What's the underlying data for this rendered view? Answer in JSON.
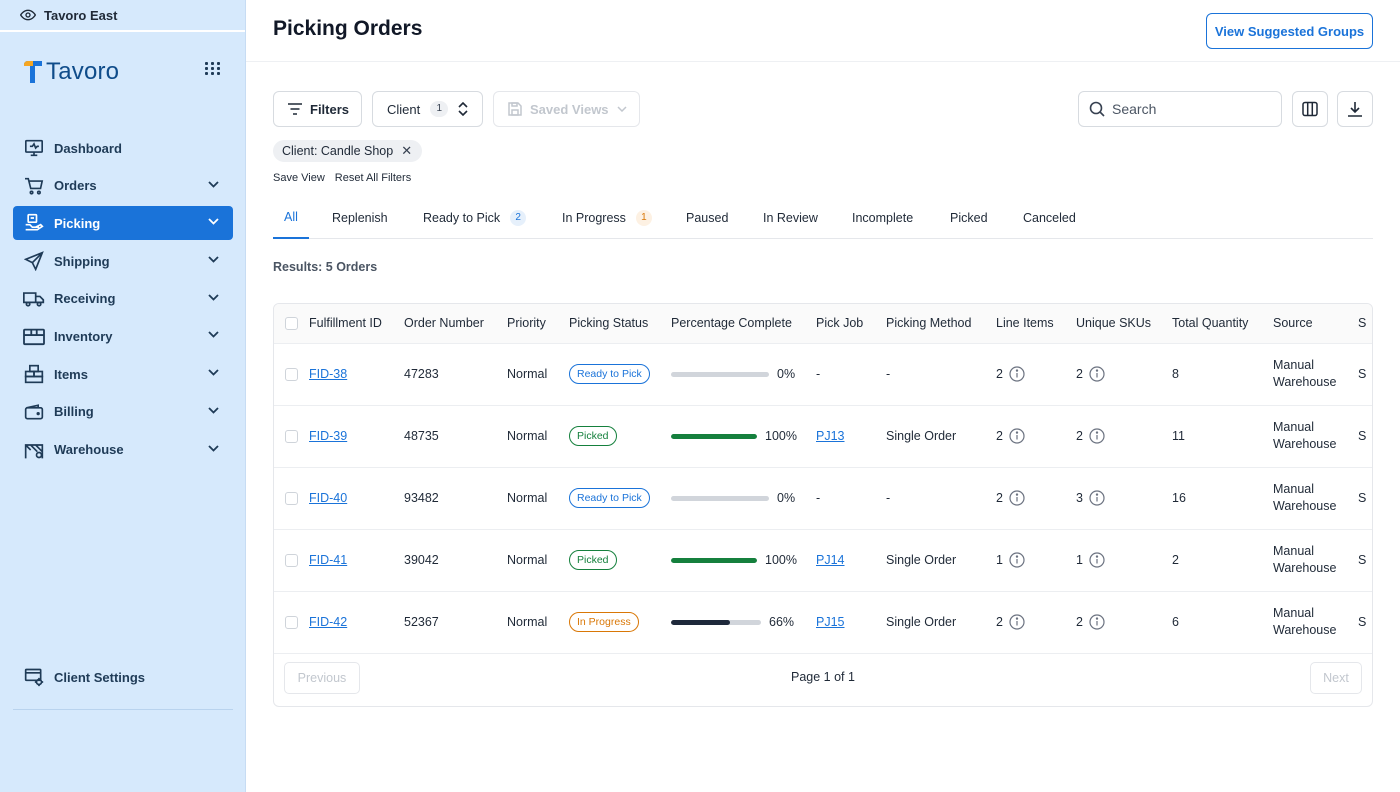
{
  "sidebar": {
    "tenant": "Tavoro East",
    "brand": "Tavoro",
    "items": [
      {
        "label": "Dashboard",
        "icon": "monitor-icon",
        "expandable": false,
        "active": false
      },
      {
        "label": "Orders",
        "icon": "cart-icon",
        "expandable": true,
        "active": false
      },
      {
        "label": "Picking",
        "icon": "picking-icon",
        "expandable": true,
        "active": true
      },
      {
        "label": "Shipping",
        "icon": "send-icon",
        "expandable": true,
        "active": false
      },
      {
        "label": "Receiving",
        "icon": "truck-icon",
        "expandable": true,
        "active": false
      },
      {
        "label": "Inventory",
        "icon": "box-icon",
        "expandable": true,
        "active": false
      },
      {
        "label": "Items",
        "icon": "boxes-icon",
        "expandable": true,
        "active": false
      },
      {
        "label": "Billing",
        "icon": "wallet-icon",
        "expandable": true,
        "active": false
      },
      {
        "label": "Warehouse",
        "icon": "warehouse-icon",
        "expandable": true,
        "active": false
      }
    ],
    "client_settings": "Client Settings"
  },
  "header": {
    "title": "Picking Orders",
    "suggest_button": "View Suggested Groups"
  },
  "toolbar": {
    "filters_label": "Filters",
    "client_label": "Client",
    "client_count": "1",
    "saved_views_label": "Saved Views",
    "search_placeholder": "Search"
  },
  "active_filter": {
    "chip": "Client: Candle Shop",
    "save_view": "Save View",
    "reset": "Reset All Filters"
  },
  "tabs": [
    {
      "label": "All",
      "badge": ""
    },
    {
      "label": "Replenish",
      "badge": ""
    },
    {
      "label": "Ready to Pick",
      "badge": "2"
    },
    {
      "label": "In Progress",
      "badge": "1"
    },
    {
      "label": "Paused",
      "badge": ""
    },
    {
      "label": "In Review",
      "badge": ""
    },
    {
      "label": "Incomplete",
      "badge": ""
    },
    {
      "label": "Picked",
      "badge": ""
    },
    {
      "label": "Canceled",
      "badge": ""
    }
  ],
  "results_text": "Results: 5 Orders",
  "table": {
    "columns": [
      "Fulfillment ID",
      "Order Number",
      "Priority",
      "Picking Status",
      "Percentage Complete",
      "Pick Job",
      "Picking Method",
      "Line Items",
      "Unique SKUs",
      "Total Quantity",
      "Source",
      "S"
    ],
    "rows": [
      {
        "id": "FID-38",
        "order": "47283",
        "priority": "Normal",
        "status": "Ready to Pick",
        "status_kind": "ready",
        "percent": 0,
        "percent_label": "0%",
        "pick_job": "-",
        "method": "-",
        "line_items": "2",
        "unique_skus": "2",
        "total_qty": "8",
        "source_1": "Manual",
        "source_2": "Warehouse",
        "extra": "S"
      },
      {
        "id": "FID-39",
        "order": "48735",
        "priority": "Normal",
        "status": "Picked",
        "status_kind": "picked",
        "percent": 100,
        "percent_label": "100%",
        "pick_job": "PJ13",
        "method": "Single Order",
        "line_items": "2",
        "unique_skus": "2",
        "total_qty": "11",
        "source_1": "Manual",
        "source_2": "Warehouse",
        "extra": "S"
      },
      {
        "id": "FID-40",
        "order": "93482",
        "priority": "Normal",
        "status": "Ready to Pick",
        "status_kind": "ready",
        "percent": 0,
        "percent_label": "0%",
        "pick_job": "-",
        "method": "-",
        "line_items": "2",
        "unique_skus": "3",
        "total_qty": "16",
        "source_1": "Manual",
        "source_2": "Warehouse",
        "extra": "S"
      },
      {
        "id": "FID-41",
        "order": "39042",
        "priority": "Normal",
        "status": "Picked",
        "status_kind": "picked",
        "percent": 100,
        "percent_label": "100%",
        "pick_job": "PJ14",
        "method": "Single Order",
        "line_items": "1",
        "unique_skus": "1",
        "total_qty": "2",
        "source_1": "Manual",
        "source_2": "Warehouse",
        "extra": "S"
      },
      {
        "id": "FID-42",
        "order": "52367",
        "priority": "Normal",
        "status": "In Progress",
        "status_kind": "progress",
        "percent": 66,
        "percent_label": "66%",
        "pick_job": "PJ15",
        "method": "Single Order",
        "line_items": "2",
        "unique_skus": "2",
        "total_qty": "6",
        "source_1": "Manual",
        "source_2": "Warehouse",
        "extra": "S"
      }
    ]
  },
  "pagination": {
    "previous": "Previous",
    "page_info": "Page 1 of 1",
    "next": "Next"
  },
  "colors": {
    "accent": "#1a73d9",
    "sidebar_bg": "#d6e9fc",
    "picked_bar": "#15803d",
    "progress_bar": "#1e293b",
    "logo_orange": "#f5a623",
    "logo_blue": "#1a73d9"
  }
}
